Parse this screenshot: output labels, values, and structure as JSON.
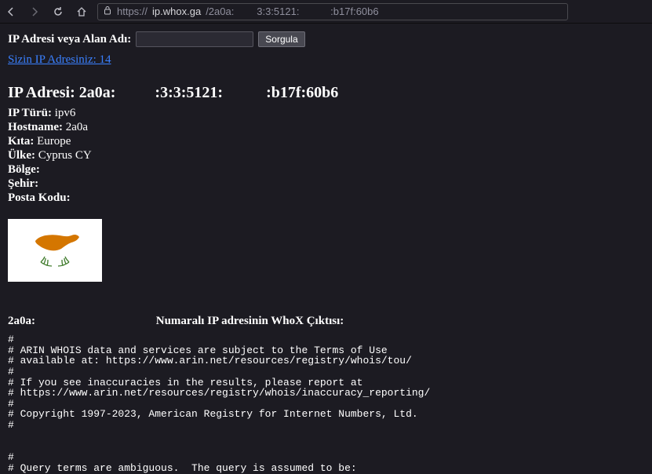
{
  "browser": {
    "url_host": "ip.whox.ga",
    "url_path": "/2a0a:        3:3:5121:           :b17f:60b6",
    "url_prefix": "https://"
  },
  "search": {
    "label": "IP Adresi veya Alan Adı:",
    "button": "Sorgula",
    "value": ""
  },
  "your_ip_link": "Sizin IP Adresiniz: 14",
  "ip_heading": {
    "label": "IP Adresi: ",
    "value": "2a0a:          :3:3:5121:           :b17f:60b6"
  },
  "fields": {
    "type_label": "IP Türü:",
    "type_value": "ipv6",
    "hostname_label": "Hostname:",
    "hostname_value": "2a0a",
    "continent_label": "Kıta:",
    "continent_value": "Europe",
    "country_label": "Ülke:",
    "country_value": "Cyprus CY",
    "region_label": "Bölge:",
    "region_value": "",
    "city_label": "Şehir:",
    "city_value": "",
    "postal_label": "Posta Kodu:",
    "postal_value": ""
  },
  "flag_country": "Cyprus",
  "whois_title": "2a0a:                                         Numaralı IP adresinin WhoX Çıktısı:",
  "whois_output": "#\n# ARIN WHOIS data and services are subject to the Terms of Use\n# available at: https://www.arin.net/resources/registry/whois/tou/\n#\n# If you see inaccuracies in the results, please report at\n# https://www.arin.net/resources/registry/whois/inaccuracy_reporting/\n#\n# Copyright 1997-2023, American Registry for Internet Numbers, Ltd.\n#\n\n\n#\n# Query terms are ambiguous.  The query is assumed to be:"
}
